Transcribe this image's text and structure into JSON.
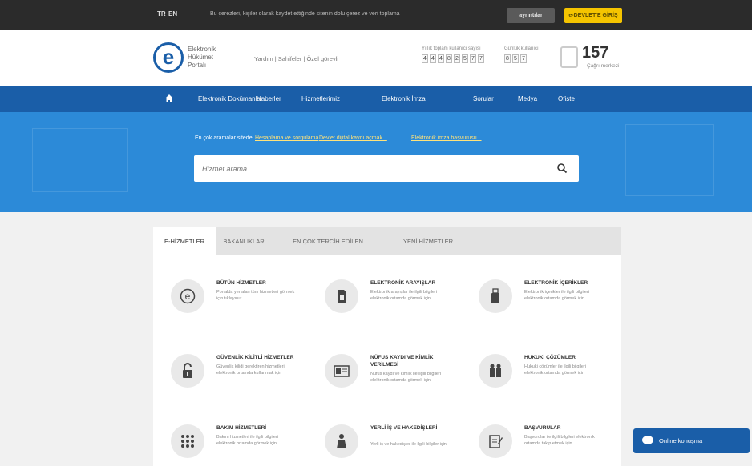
{
  "topbar": {
    "lang_tr": "TR",
    "lang_en": "EN",
    "notice": "Bu çerezleri, kişiler olarak kaydet ettiğinde sitenin dolu çerez ve veri toplama",
    "btn_details": "ayrıntılar",
    "btn_login": "e-DEVLET'E GİRİŞ"
  },
  "header": {
    "logo_line1": "Elektronik",
    "logo_line2": "Hükümet",
    "logo_line3": "Portalı",
    "links": "Yardım  |  Sahifeler  |  Özel görevli",
    "counter1_label": "Yıllık toplam kullanıcı sayısı",
    "counter1_digits": [
      "4",
      "4",
      "4",
      "8",
      "2",
      "5",
      "7",
      "7"
    ],
    "counter2_label": "Günlük kullanıcı",
    "counter2_digits": [
      "8",
      "5",
      "7"
    ],
    "call_number": "157",
    "call_label": "Çağrı merkezi"
  },
  "nav": {
    "items": [
      "Elektronik Dokümanlar",
      "Haberler",
      "Hizmetlerimiz",
      "Elektronik İmza",
      "Sorular",
      "Medya",
      "Ofiste"
    ]
  },
  "hero": {
    "most_label": "En çok aramalar sitede:",
    "link1": "Hesaplama ve sorgulama",
    "link2": "Devlet dijital kaydı açmak...",
    "link3": "Elektronik imza başvurusu...",
    "search_placeholder": "Hizmet arama"
  },
  "tabs": [
    "E-HİZMETLER",
    "BAKANLIKLAR",
    "EN ÇOK TERCİH EDİLEN",
    "YENİ HİZMETLER"
  ],
  "services": [
    {
      "title": "BÜTÜN HİZMETLER",
      "desc": "Portalda yer alan tüm hizmetleri görmek için tıklayınız",
      "icon": "e-logo-icon"
    },
    {
      "title": "ELEKTRONİK ARAYIŞLAR",
      "desc": "Elektronik arayışlar ile ilgili bilgileri elektronik ortamda görmek için",
      "icon": "sim-card-icon"
    },
    {
      "title": "ELEKTRONİK İÇERİKLER",
      "desc": "Elektronik içerikler ile ilgili bilgileri elektronik ortamda görmek için",
      "icon": "usb-icon"
    },
    {
      "title": "GÜVENLİK KİLİTLİ HİZMETLER",
      "desc": "Güvenlik kilidi gerektiren hizmetleri elektronik ortamda kullanmak için",
      "icon": "unlock-icon"
    },
    {
      "title": "NÜFUS KAYDI VE KİMLİK VERİLMESİ",
      "desc": "Nüfus kaydı ve kimlik ile ilgili bilgileri elektronik ortamda görmek için",
      "icon": "id-card-icon"
    },
    {
      "title": "HUKUKİ ÇÖZÜMLER",
      "desc": "Hukuki çözümler ile ilgili bilgileri elektronik ortamda görmek için",
      "icon": "family-icon"
    },
    {
      "title": "BAKIM HİZMETLERİ",
      "desc": "Bakım hizmetleri ile ilgili bilgileri elektronik ortamda görmek için",
      "icon": "grid-icon"
    },
    {
      "title": "YERLİ İŞ VE HAKEDİŞLERİ",
      "desc": "Yerli iş ve hakedişler ile ilgili bilgiler için",
      "icon": "worker-icon"
    },
    {
      "title": "BAŞVURULAR",
      "desc": "Başvurular ile ilgili bilgileri elektronik ortamda takip etmek için",
      "icon": "form-icon"
    }
  ],
  "chat": {
    "label": "Online konuşma"
  }
}
